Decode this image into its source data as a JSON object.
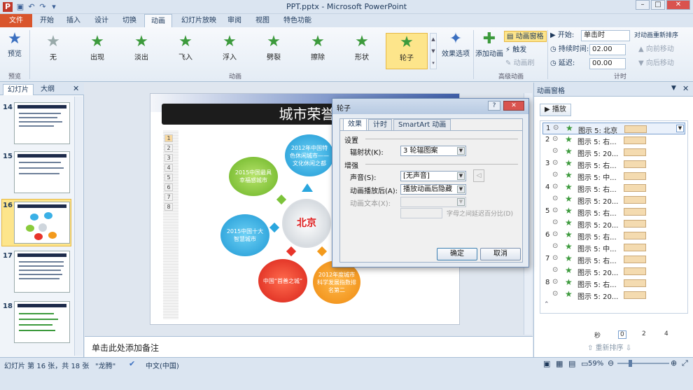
{
  "window": {
    "title": "PPT.pptx - Microsoft PowerPoint"
  },
  "tabs": [
    "文件",
    "开始",
    "插入",
    "设计",
    "切换",
    "动画",
    "幻灯片放映",
    "审阅",
    "视图",
    "特色功能"
  ],
  "ribbon": {
    "preview": "预览",
    "preview_group": "预览",
    "animations": [
      "无",
      "出现",
      "淡出",
      "飞入",
      "浮入",
      "劈裂",
      "擦除",
      "形状",
      "轮子"
    ],
    "animation_group": "动画",
    "effect_options": "效果选项",
    "add_animation": "添加动画",
    "anim_pane": "动画窗格",
    "trigger": "触发",
    "anim_painter": "动画刷",
    "advanced_group": "高级动画",
    "start_label": "开始:",
    "start_value": "单击时",
    "duration_label": "持续时间:",
    "duration_value": "02.00",
    "delay_label": "延迟:",
    "delay_value": "00.00",
    "reorder": "对动画重新排序",
    "move_earlier": "向前移动",
    "move_later": "向后移动",
    "timing_group": "计时"
  },
  "left_panel": {
    "tab_slides": "幻灯片",
    "tab_outline": "大纲",
    "slide_numbers": [
      "14",
      "15",
      "16",
      "17",
      "18"
    ]
  },
  "slide": {
    "title": "城市荣誉",
    "list_numbers": [
      "1",
      "2",
      "3",
      "4",
      "5",
      "6",
      "7",
      "8"
    ],
    "clouds": [
      "2012年中国特色休闲城市——文化休闲之都",
      "2015中国最具幸福感城市",
      "2015中国十大智慧城市",
      "中国“首善之城”",
      "2012年度城市科学发展指数排名第二"
    ],
    "center": "北京"
  },
  "notes": {
    "placeholder": "单击此处添加备注"
  },
  "pane": {
    "title": "动画窗格",
    "play": "播放",
    "rows": [
      {
        "n": "1",
        "text": "图示 5: 北京"
      },
      {
        "n": "2",
        "text": "图示 5: 右..."
      },
      {
        "n": "",
        "text": "图示 5: 20..."
      },
      {
        "n": "3",
        "text": "图示 5: 右..."
      },
      {
        "n": "",
        "text": "图示 5: 中..."
      },
      {
        "n": "4",
        "text": "图示 5: 右..."
      },
      {
        "n": "",
        "text": "图示 5: 20..."
      },
      {
        "n": "5",
        "text": "图示 5: 右..."
      },
      {
        "n": "",
        "text": "图示 5: 20..."
      },
      {
        "n": "6",
        "text": "图示 5: 右..."
      },
      {
        "n": "",
        "text": "图示 5: 中..."
      },
      {
        "n": "7",
        "text": "图示 5: 右..."
      },
      {
        "n": "",
        "text": "图示 5: 20..."
      },
      {
        "n": "8",
        "text": "图示 5: 右..."
      },
      {
        "n": "",
        "text": "图示 5: 20..."
      }
    ],
    "seconds": "秒",
    "scale": [
      "0",
      "2",
      "4"
    ],
    "reorder": "重新排序"
  },
  "dialog": {
    "title": "轮子",
    "tabs": [
      "效果",
      "计时",
      "SmartArt 动画"
    ],
    "settings": "设置",
    "spokes_label": "辐射状(K):",
    "spokes_value": "3 轮辐图案",
    "enhance": "增强",
    "sound_label": "声音(S):",
    "sound_value": "[无声音]",
    "after_label": "动画播放后(A):",
    "after_value": "播放动画后隐藏",
    "text_label": "动画文本(X):",
    "delay_pct": "字母之间延迟百分比(D)",
    "ok": "确定",
    "cancel": "取消"
  },
  "status": {
    "slide_info": "幻灯片 第 16 张，共 18 张",
    "theme": "\"龙腾\"",
    "lang": "中文(中国)",
    "zoom": "59%"
  }
}
